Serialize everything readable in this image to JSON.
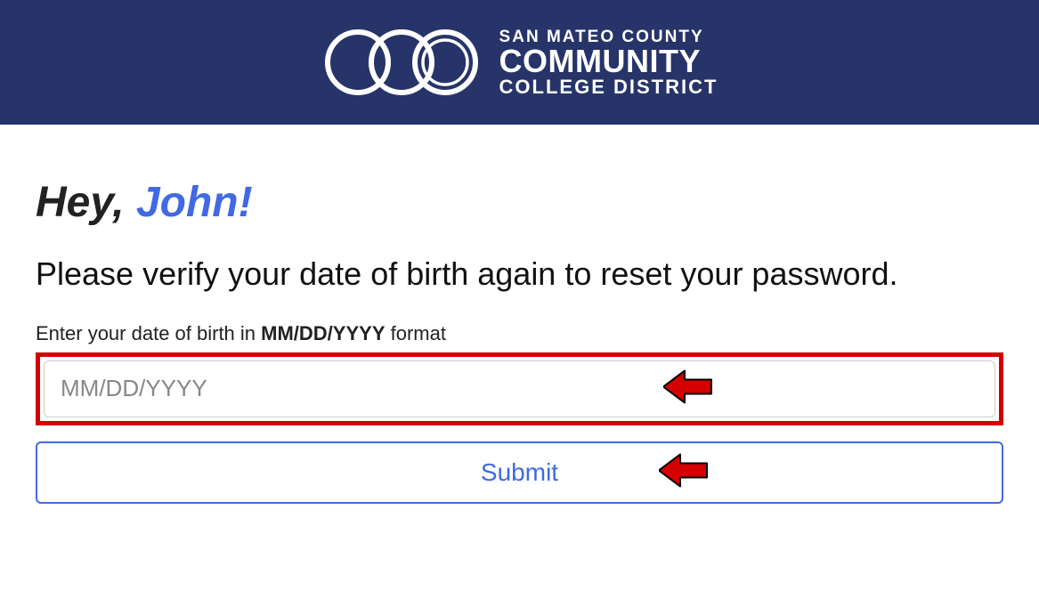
{
  "header": {
    "org_line1": "SAN MATEO COUNTY",
    "org_line2": "COMMUNITY",
    "org_line3": "COLLEGE DISTRICT"
  },
  "main": {
    "greeting_prefix": "Hey, ",
    "greeting_name": "John!",
    "instruction": "Please verify your date of birth again to reset your password.",
    "label_pre": "Enter your date of birth in ",
    "label_format": "MM/DD/YYYY",
    "label_post": " format",
    "dob_placeholder": "MM/DD/YYYY",
    "submit_label": "Submit"
  },
  "colors": {
    "header_bg": "#273469",
    "accent": "#4169E1",
    "highlight_border": "#d40000",
    "arrow_fill": "#d40000"
  }
}
